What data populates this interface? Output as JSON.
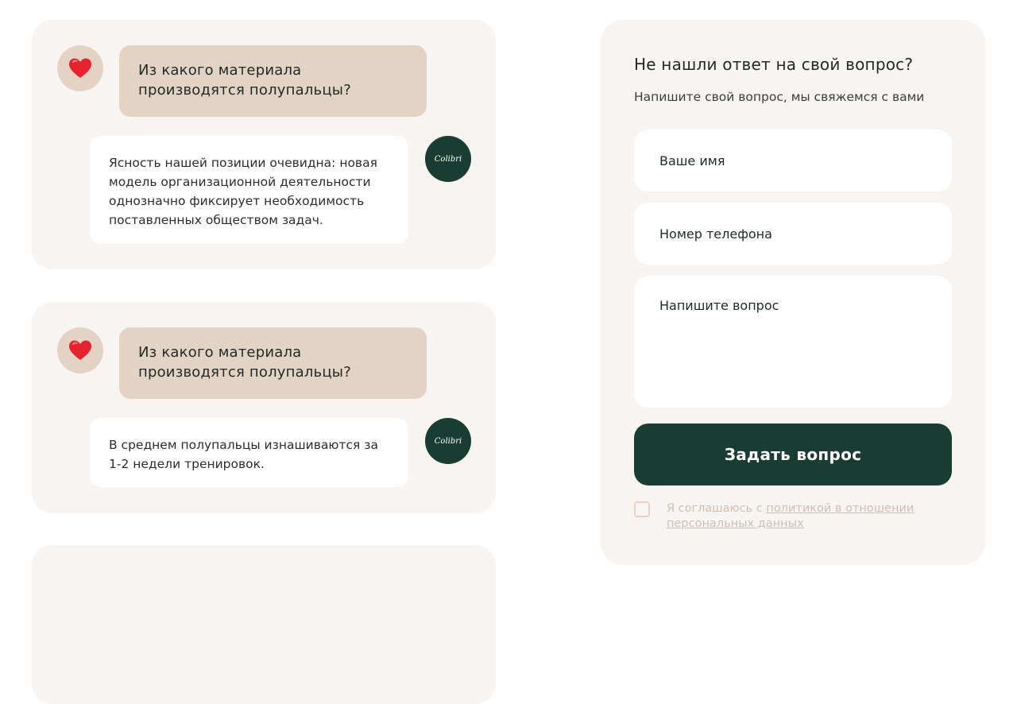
{
  "faq": [
    {
      "user_icon": "heart-icon",
      "question": "Из какого материала производятся полупальцы?",
      "answer": "Ясность нашей позиции очевидна: новая модель организационной деятельности однозначно фиксирует необходимость поставленных обществом задач.",
      "brand_logo_text": "Colibri"
    },
    {
      "user_icon": "heart-icon",
      "question": "Из какого материала производятся полупальцы?",
      "answer": "В среднем полупальцы изнашиваются за 1-2 недели тренировок.",
      "brand_logo_text": "Colibri"
    }
  ],
  "form": {
    "title": "Не нашли ответ на свой вопрос?",
    "subtitle": "Напишите свой вопрос, мы свяжемся с вами",
    "name_placeholder": "Ваше имя",
    "phone_placeholder": "Номер телефона",
    "question_placeholder": "Напишите вопрос",
    "submit_label": "Задать вопрос",
    "consent_prefix": "Я соглашаюсь с ",
    "consent_link": "политикой в отношении персональных данных"
  },
  "colors": {
    "accent": "#1a3d33",
    "card_bg": "#f8f4f1",
    "question_bg": "#e3d3c4"
  }
}
